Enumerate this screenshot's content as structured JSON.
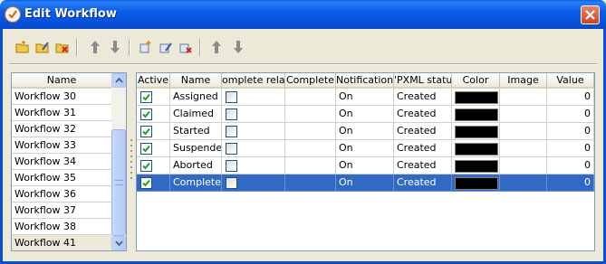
{
  "window": {
    "title": "Edit Workflow",
    "close_icon": "close-icon",
    "app_icon": "checkmark-badge-icon"
  },
  "toolbar": {
    "groups": [
      [
        "add-workflow-icon",
        "edit-workflow-icon",
        "delete-workflow-icon"
      ],
      [
        "move-up-icon",
        "move-down-icon"
      ],
      [
        "add-status-icon",
        "edit-status-icon",
        "delete-status-icon"
      ],
      [
        "move-up-icon",
        "move-down-icon"
      ]
    ]
  },
  "workflows": {
    "header": "Name",
    "items": [
      "Workflow 30",
      "Workflow 31",
      "Workflow 32",
      "Workflow 33",
      "Workflow 34",
      "Workflow 35",
      "Workflow 36",
      "Workflow 37",
      "Workflow 38",
      "Workflow 41"
    ],
    "selected_index": 9
  },
  "statuses": {
    "columns": [
      "Active",
      "Name",
      "omplete relate",
      "Complete",
      "Notification",
      "'PXML statu",
      "Color",
      "Image",
      "Value"
    ],
    "rows": [
      {
        "active": true,
        "name": "Assigned",
        "complete_related": false,
        "complete": "",
        "notification": "On",
        "pxml_status": "Created",
        "color": "#000000",
        "image": "",
        "value": "0"
      },
      {
        "active": true,
        "name": "Claimed",
        "complete_related": false,
        "complete": "",
        "notification": "On",
        "pxml_status": "Created",
        "color": "#000000",
        "image": "",
        "value": "0"
      },
      {
        "active": true,
        "name": "Started",
        "complete_related": false,
        "complete": "",
        "notification": "On",
        "pxml_status": "Created",
        "color": "#000000",
        "image": "",
        "value": "0"
      },
      {
        "active": true,
        "name": "Suspended",
        "complete_related": false,
        "complete": "",
        "notification": "On",
        "pxml_status": "Created",
        "color": "#000000",
        "image": "",
        "value": "0"
      },
      {
        "active": true,
        "name": "Aborted",
        "complete_related": false,
        "complete": "",
        "notification": "On",
        "pxml_status": "Created",
        "color": "#000000",
        "image": "",
        "value": "0"
      },
      {
        "active": true,
        "name": "Completed",
        "complete_related": false,
        "complete": "",
        "notification": "On",
        "pxml_status": "Created",
        "color": "#000000",
        "image": "",
        "value": "0"
      }
    ],
    "selected_index": 5
  },
  "colors": {
    "selection": "#316ac5",
    "titlebar": "#0a5fe8",
    "dialog_bg": "#ece9d8",
    "check": "#21a121"
  }
}
